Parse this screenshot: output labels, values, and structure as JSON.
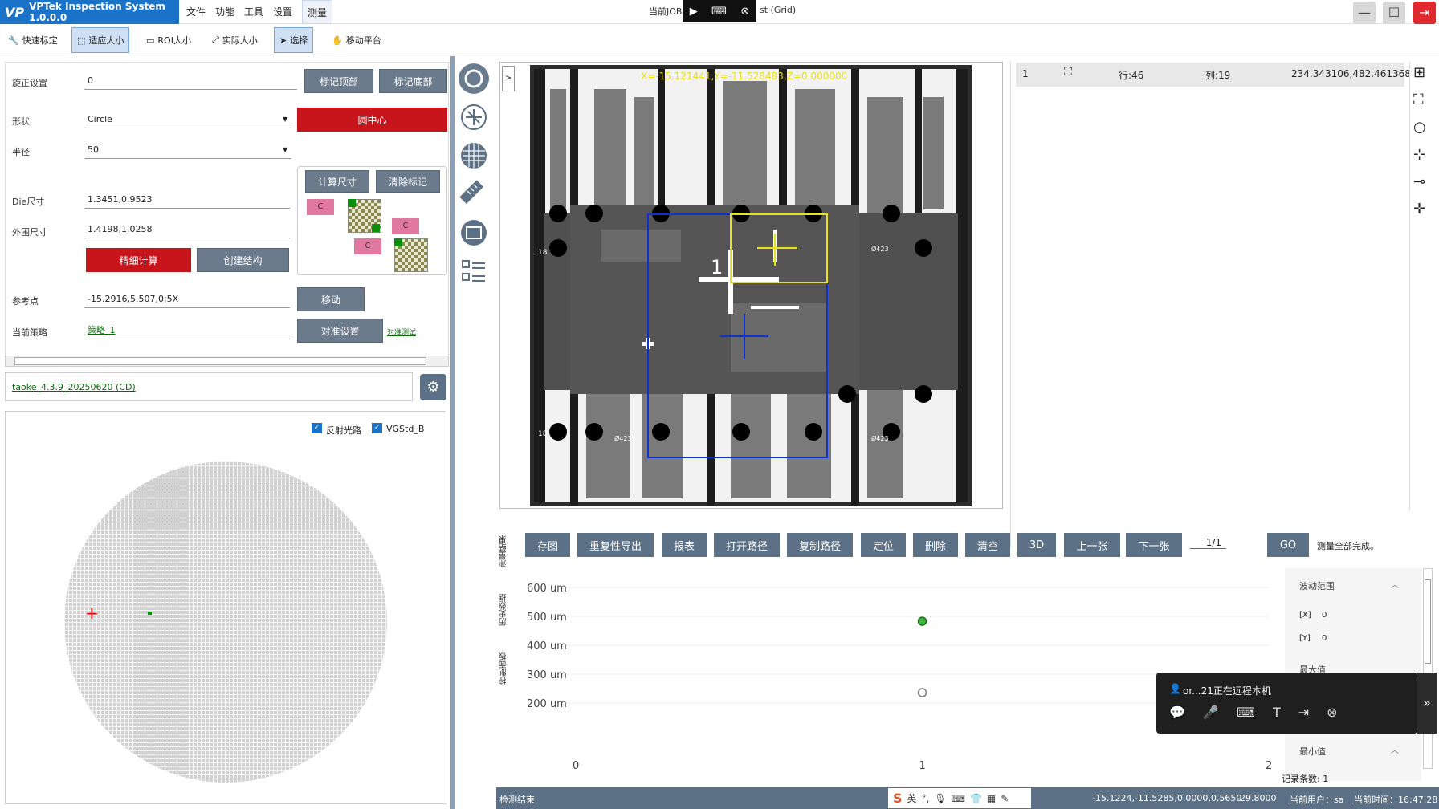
{
  "app": {
    "title": "VPTek Inspection System 1.0.0.0",
    "logo": "VP",
    "job_prefix": "当前JOB",
    "job_suffix": "st (Grid)"
  },
  "menu": [
    "文件",
    "功能",
    "工具",
    "设置",
    "测量"
  ],
  "toolbar": [
    "快速标定",
    "适应大小",
    "ROI大小",
    "实际大小",
    "选择",
    "移动平台"
  ],
  "left": {
    "rotation_label": "旋正设置",
    "rotation_value": "0",
    "mark_top": "标记顶部",
    "mark_bottom": "标记底部",
    "shape_label": "形状",
    "shape_value": "Circle",
    "circle_center": "圆中心",
    "radius_label": "半径",
    "radius_value": "50",
    "calc_size": "计算尺寸",
    "clear_mark": "清除标记",
    "c": "C",
    "die_label": "Die尺寸",
    "die_value": "1.3451,0.9523",
    "outer_label": "外围尺寸",
    "outer_value": "1.4198,1.0258",
    "fine_calc": "精细计算",
    "create_struct": "创建结构",
    "ref_label": "参考点",
    "ref_value": "-15.2916,5.507,0;5X",
    "move": "移动",
    "strategy_label": "当前策略",
    "strategy_value": "策略_1",
    "align_setup": "对准设置",
    "align_test": "对准测试",
    "recipe": "taoke_4.3.9_20250620 (CD)",
    "chk_reflect": "反射光路",
    "chk_vg": "VGStd_B"
  },
  "image": {
    "coord_text": "X=-15.121441,Y=-11.528483,Z=0.000000",
    "die_number": "1",
    "pad_labels": [
      "18",
      "18",
      "Ø423",
      "Ø423",
      "Ø423"
    ]
  },
  "result_row": {
    "index": "1",
    "row": "行:46",
    "col": "列:19",
    "coords": "234.343106,482.461368"
  },
  "vtabs": [
    "测量结果",
    "历史数据",
    "控制面板"
  ],
  "bottom_buttons": [
    "存图",
    "重复性导出",
    "报表",
    "打开路径",
    "复制路径",
    "定位",
    "删除",
    "清空",
    "3D",
    "上一张",
    "下一张"
  ],
  "page": "1/1",
  "go": "GO",
  "done": "测量全部完成。",
  "chart_data": {
    "type": "scatter",
    "ylabels": [
      "600 um",
      "500 um",
      "400 um",
      "300 um",
      "200 um"
    ],
    "xlabels": [
      "0",
      "1",
      "2"
    ],
    "points": [
      {
        "x": 1,
        "y": 483,
        "style": "filled-green"
      },
      {
        "x": 1,
        "y": 236,
        "style": "hollow-gray"
      }
    ],
    "ylim": [
      200,
      600
    ],
    "xlim": [
      0,
      2
    ]
  },
  "range_panel": {
    "title": "波动范围",
    "x_label": "[X]",
    "x_val": "0",
    "y_label": "[Y]",
    "y_val": "0",
    "max_label": "最大值",
    "min_label": "最小值",
    "record": "记录条数: 1"
  },
  "remote": {
    "text": "or...21正在远程本机"
  },
  "status": {
    "left": "检测结束",
    "ime": "英",
    "coords": "-15.1224,-11.5285,0.0000,0.5650",
    "z": "-29.8000",
    "user": "当前用户：sa",
    "time": "当前时间：16:47:28"
  }
}
